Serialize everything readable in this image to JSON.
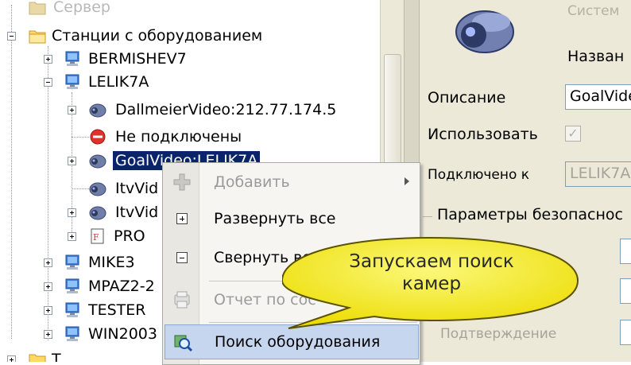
{
  "tree": {
    "items": [
      {
        "label": "Сервер",
        "icon": "folder-icon"
      },
      {
        "label": "Станции с оборудованием",
        "icon": "folder-icon"
      },
      {
        "label": "BERMISHEV7",
        "icon": "computer-icon"
      },
      {
        "label": "LELIK7A",
        "icon": "computer-icon"
      },
      {
        "label": "DallmeierVideo:212.77.174.5",
        "icon": "camera-icon"
      },
      {
        "label": "Не подключены",
        "icon": "no-entry-icon"
      },
      {
        "label": "GoalVideo:LELIK7A",
        "icon": "camera-icon"
      },
      {
        "label": "ItvVid",
        "icon": "camera-icon"
      },
      {
        "label": "ItvVid",
        "icon": "camera-icon"
      },
      {
        "label": "PRO",
        "icon": "report-icon"
      },
      {
        "label": "MIKE3",
        "icon": "computer-icon"
      },
      {
        "label": "MPAZ2-2",
        "icon": "computer-icon"
      },
      {
        "label": "TESTER",
        "icon": "computer-icon"
      },
      {
        "label": "WIN2003",
        "icon": "computer-icon"
      },
      {
        "label": "Т",
        "icon": "folder-icon"
      }
    ]
  },
  "props": {
    "section_title": "Систем",
    "name_label": "Назван",
    "description_label": "Описание",
    "description_value": "GoalVide",
    "use_label": "Использовать",
    "connected_label": "Подключено к",
    "connected_value": "LELIK7A",
    "security_label": "Параметры безопаснос",
    "confirm_label": "Подтверждение"
  },
  "menu": {
    "items": [
      {
        "label": "Добавить",
        "icon": "add-icon",
        "disabled": true,
        "submenu": true
      },
      {
        "label": "Развернуть все",
        "icon": "expand-all-icon",
        "disabled": false
      },
      {
        "label": "Свернуть все",
        "icon": "collapse-all-icon",
        "disabled": false
      },
      {
        "label": "Отчет по сос",
        "icon": "report-icon",
        "disabled": true
      },
      {
        "label": "Поиск оборудования",
        "icon": "search-equipment-icon",
        "disabled": false,
        "highlighted": true
      }
    ]
  },
  "callout": {
    "line1": "Запускаем поиск",
    "line2": "камер"
  },
  "colors": {
    "selection": "#0a246a",
    "panel_bg": "#ece9d8",
    "menu_highlight": "#c6d6ee",
    "callout_fill": "#f7f214"
  }
}
